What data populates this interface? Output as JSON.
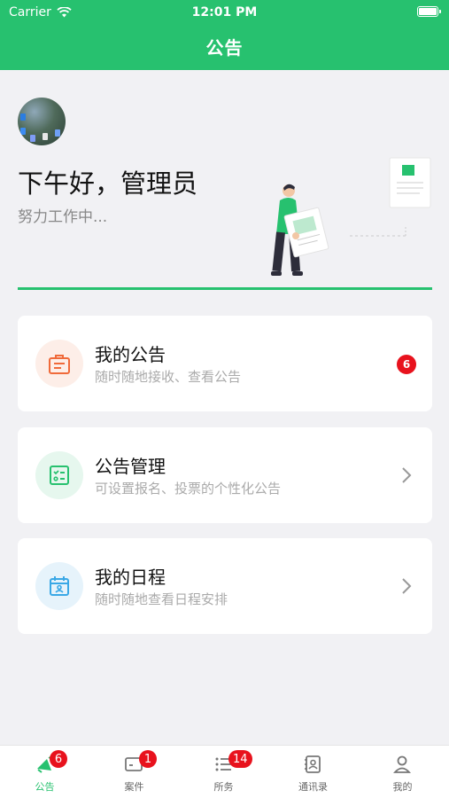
{
  "status_bar": {
    "carrier": "Carrier",
    "time": "12:01 PM"
  },
  "nav": {
    "title": "公告"
  },
  "header": {
    "greeting": "下午好，管理员",
    "subtitle": "努力工作中..."
  },
  "cards": [
    {
      "title": "我的公告",
      "desc": "随时随地接收、查看公告",
      "badge": "6",
      "icon": "announcement-icon",
      "accent": "#f06a3a"
    },
    {
      "title": "公告管理",
      "desc": "可设置报名、投票的个性化公告",
      "icon": "checklist-icon",
      "accent": "#27c16f"
    },
    {
      "title": "我的日程",
      "desc": "随时随地查看日程安排",
      "icon": "calendar-icon",
      "accent": "#3aa8e6"
    }
  ],
  "tabs": [
    {
      "label": "公告",
      "badge": "6",
      "active": true
    },
    {
      "label": "案件",
      "badge": "1"
    },
    {
      "label": "所务",
      "badge": "14"
    },
    {
      "label": "通讯录"
    },
    {
      "label": "我的"
    }
  ],
  "colors": {
    "brand": "#27c16f",
    "badge": "#e8121d",
    "background": "#f1f1f4"
  }
}
